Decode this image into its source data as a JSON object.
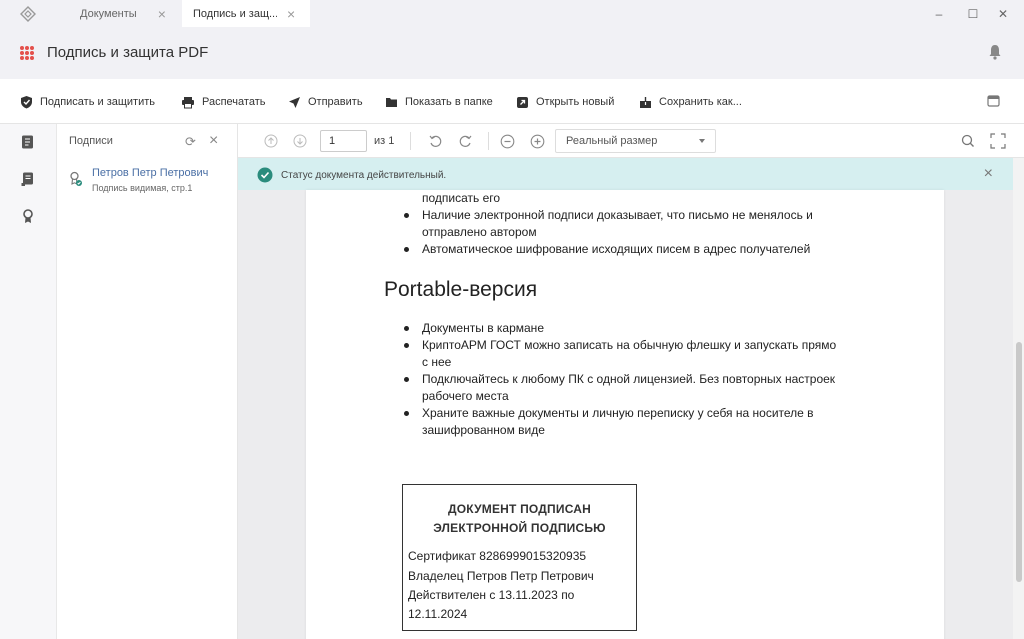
{
  "tabs": [
    {
      "label": "Документы"
    },
    {
      "label": "Подпись и защ..."
    }
  ],
  "window_controls": {
    "minimize": "–",
    "maximize": "☐",
    "close": "✕"
  },
  "header": {
    "title": "Подпись и защита PDF"
  },
  "toolbar": {
    "sign_protect": "Подписать и защитить",
    "print": "Распечатать",
    "send": "Отправить",
    "show_in_folder": "Показать в папке",
    "open_new": "Открыть новый",
    "save_as": "Сохранить как..."
  },
  "signatures_panel": {
    "title": "Подписи",
    "items": [
      {
        "name": "Петров Петр Петрович",
        "desc": "Подпись видимая, стр.1"
      }
    ]
  },
  "viewer": {
    "page_value": "1",
    "page_of": "из 1",
    "zoom": "Реальный размер"
  },
  "status": {
    "text": "Статус документа действительный."
  },
  "document": {
    "list1": [
      {
        "text": "подписать его",
        "bullet": false
      },
      {
        "text": "Наличие электронной подписи доказывает, что письмо не менялось и",
        "bullet": true
      },
      {
        "text": "отправлено автором",
        "bullet": false
      },
      {
        "text": "Автоматическое шифрование исходящих писем в адрес получателей",
        "bullet": true
      }
    ],
    "heading": "Portable-версия",
    "list2": [
      {
        "text": "Документы в кармане",
        "bullet": true
      },
      {
        "text": "КриптоАРМ ГОСТ можно записать на обычную флешку и запускать прямо",
        "bullet": true
      },
      {
        "text": "с нее",
        "bullet": false
      },
      {
        "text": "Подключайтесь к любому ПК с одной лицензией. Без повторных настроек",
        "bullet": true
      },
      {
        "text": "рабочего места",
        "bullet": false
      },
      {
        "text": "Храните важные документы и личную переписку у себя на носителе в",
        "bullet": true
      },
      {
        "text": "зашифрованном виде",
        "bullet": false
      }
    ],
    "stamp": {
      "title1": "ДОКУМЕНТ ПОДПИСАН",
      "title2": "ЭЛЕКТРОННОЙ ПОДПИСЬЮ",
      "cert": "Сертификат 8286999015320935",
      "owner": "Владелец Петров Петр Петрович",
      "valid1": "Действителен с 13.11.2023 по",
      "valid2": "12.11.2024"
    }
  },
  "colors": {
    "accent_red": "#e4504b",
    "link_blue": "#4a6fa5",
    "status_bg": "#d6eff0",
    "status_ok": "#2a8c7d"
  }
}
